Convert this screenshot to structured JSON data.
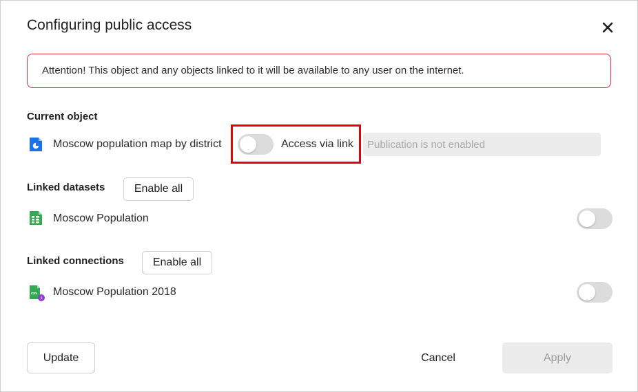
{
  "dialog": {
    "title": "Configuring public access",
    "close_icon": "close-icon",
    "alert_text": "Attention! This object and any objects linked to it will be available to any user on the internet."
  },
  "current_object": {
    "section_title": "Current object",
    "icon": "chart-pie-icon",
    "name": "Moscow population map by district",
    "toggle_on": false,
    "access_label": "Access via link",
    "link_placeholder": "Publication is not enabled"
  },
  "linked_datasets": {
    "section_title": "Linked datasets",
    "enable_all_label": "Enable all",
    "items": [
      {
        "icon": "dataset-table-icon",
        "name": "Moscow Population",
        "toggle_on": false
      }
    ]
  },
  "linked_connections": {
    "section_title": "Linked connections",
    "enable_all_label": "Enable all",
    "items": [
      {
        "icon": "csv-file-icon",
        "name": "Moscow Population 2018",
        "toggle_on": false
      }
    ]
  },
  "footer": {
    "update_label": "Update",
    "cancel_label": "Cancel",
    "apply_label": "Apply"
  },
  "colors": {
    "alert_border": "#e0323c",
    "highlight_border": "#e3000f",
    "chart_icon": "#1a73e8",
    "dataset_icon": "#34a853",
    "connection_badge": "#8e3bd9"
  }
}
